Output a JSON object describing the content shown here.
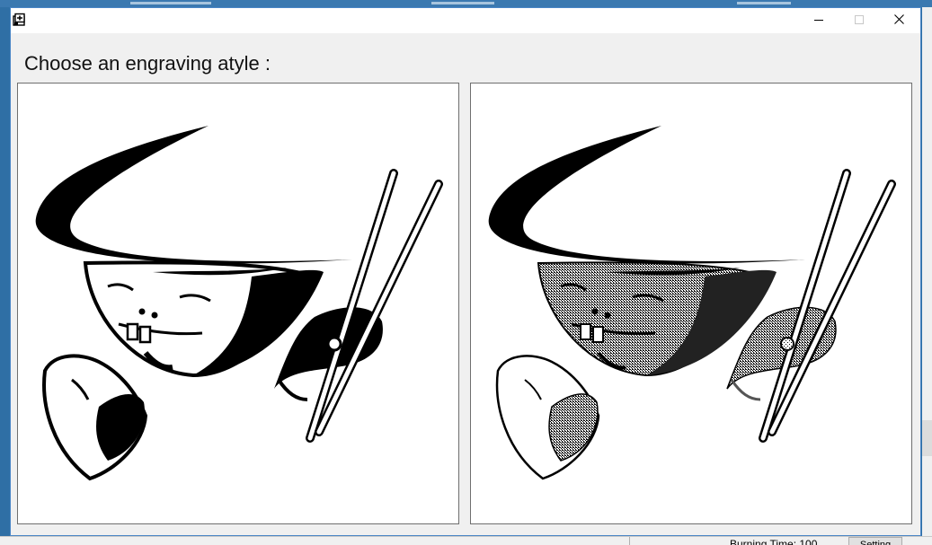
{
  "window": {
    "title": "",
    "icon": "app-engrave-icon",
    "controls": {
      "minimize": "minimize-icon",
      "maximize": "maximize-icon",
      "close": "close-icon"
    }
  },
  "main": {
    "prompt": "Choose an engraving atyle :",
    "styles": [
      {
        "id": "threshold",
        "image": "chef-chopsticks-black-white"
      },
      {
        "id": "dither",
        "image": "chef-chopsticks-dithered"
      }
    ]
  },
  "background_app": {
    "status": "Burning Time:  100",
    "setting_button": "Setting"
  },
  "colors": {
    "window_border": "#4a86c6",
    "desktop": "#2f6fa5",
    "panel_bg": "#ffffff",
    "ink": "#000000",
    "dither_gray": "#555555"
  }
}
